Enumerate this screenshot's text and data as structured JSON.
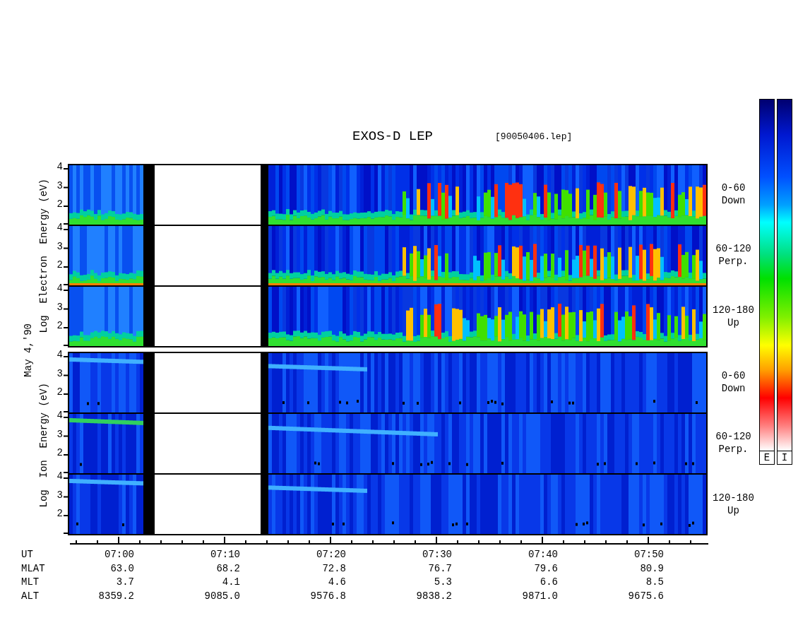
{
  "title": "EXOS-D LEP",
  "file": "[90050406.lep]",
  "date": "May 4,'90",
  "groups": [
    {
      "kind": "electron",
      "label": "Log  Electron  Energy (eV)",
      "panels": [
        {
          "yticks": [
            "4",
            "3",
            "2"
          ],
          "pitch": "0-60",
          "direction": "Down"
        },
        {
          "yticks": [
            "4",
            "3",
            "2"
          ],
          "pitch": "60-120",
          "direction": "Perp."
        },
        {
          "yticks": [
            "4",
            "3",
            "2"
          ],
          "pitch": "120-180",
          "direction": "Up"
        }
      ]
    },
    {
      "kind": "ion",
      "label": "Log  Ion  Energy (eV)",
      "panels": [
        {
          "yticks": [
            "4",
            "3",
            "2"
          ],
          "pitch": "0-60",
          "direction": "Down"
        },
        {
          "yticks": [
            "4",
            "3",
            "2"
          ],
          "pitch": "60-120",
          "direction": "Perp."
        },
        {
          "yticks": [
            "4",
            "3",
            "2"
          ],
          "pitch": "120-180",
          "direction": "Up"
        }
      ]
    }
  ],
  "time_table": [
    {
      "label": "UT",
      "values": [
        "07:00",
        "07:10",
        "07:20",
        "07:30",
        "07:40",
        "07:50"
      ]
    },
    {
      "label": "MLAT",
      "values": [
        "63.0",
        "68.2",
        "72.8",
        "76.7",
        "79.6",
        "80.9"
      ]
    },
    {
      "label": "MLT",
      "values": [
        "3.7",
        "4.1",
        "4.6",
        "5.3",
        "6.6",
        "8.5"
      ]
    },
    {
      "label": "ALT",
      "values": [
        "8359.2",
        "9085.0",
        "9576.8",
        "9838.2",
        "9871.0",
        "9675.6"
      ]
    }
  ],
  "colorbars": [
    {
      "label": "E"
    },
    {
      "label": "I"
    }
  ]
}
